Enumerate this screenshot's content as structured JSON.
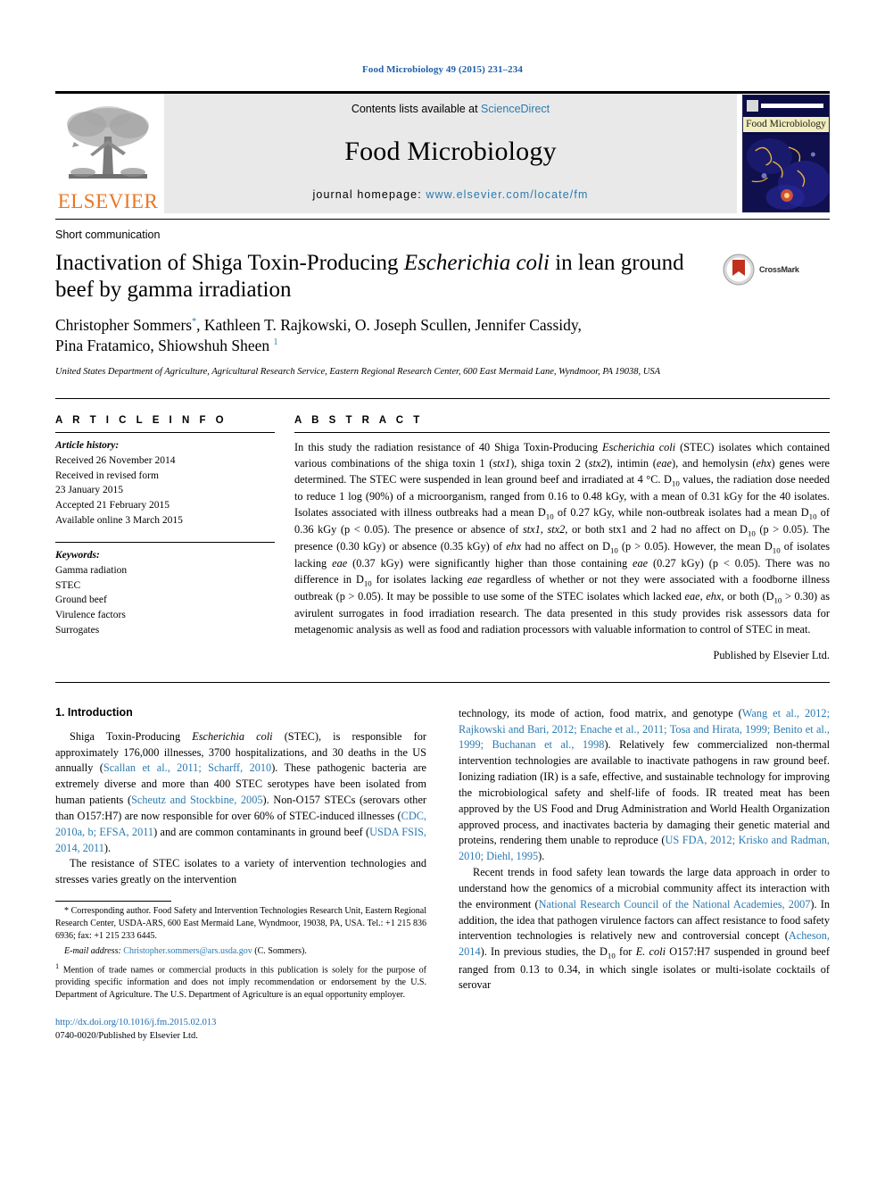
{
  "running_head": "Food Microbiology 49 (2015) 231–234",
  "masthead": {
    "publisher_name": "ELSEVIER",
    "contents_prefix": "Contents lists available at ",
    "contents_link": "ScienceDirect",
    "journal_title": "Food Microbiology",
    "homepage_prefix": "journal homepage: ",
    "homepage_url": "www.elsevier.com/locate/fm",
    "cover_label": "Food Microbiology"
  },
  "article": {
    "doctype": "Short communication",
    "title_part1": "Inactivation of Shiga Toxin-Producing ",
    "title_italic": "Escherichia coli",
    "title_part2": " in lean ground beef by gamma irradiation",
    "crossmark_label": "CrossMark",
    "authors_line1": "Christopher Sommers",
    "authors_line1_sup": "*",
    "authors_line1_rest": ", Kathleen T. Rajkowski, O. Joseph Scullen, Jennifer Cassidy,",
    "authors_line2": "Pina Fratamico, Shiowshuh Sheen",
    "authors_line2_sup": "1",
    "affiliation": "United States Department of Agriculture, Agricultural Research Service, Eastern Regional Research Center, 600 East Mermaid Lane, Wyndmoor, PA 19038, USA"
  },
  "info": {
    "heading": "A R T I C L E  I N F O",
    "history_label": "Article history:",
    "history": [
      "Received 26 November 2014",
      "Received in revised form",
      "23 January 2015",
      "Accepted 21 February 2015",
      "Available online 3 March 2015"
    ],
    "keywords_label": "Keywords:",
    "keywords": [
      "Gamma radiation",
      "STEC",
      "Ground beef",
      "Virulence factors",
      "Surrogates"
    ]
  },
  "abstract": {
    "heading": "A B S T R A C T",
    "published_by": "Published by Elsevier Ltd."
  },
  "introduction": {
    "heading": "1. Introduction"
  },
  "footnotes": {
    "corresponding": "* Corresponding author. Food Safety and Intervention Technologies Research Unit, Eastern Regional Research Center, USDA-ARS, 600 East Mermaid Lane, Wyndmoor, 19038, PA, USA. Tel.: +1 215 836 6936; fax: +1 215 233 6445.",
    "email_label": "E-mail address:",
    "email": "Christopher.sommers@ars.usda.gov",
    "email_suffix": " (C. Sommers).",
    "note1_marker": "1",
    "note1": " Mention of trade names or commercial products in this publication is solely for the purpose of providing specific information and does not imply recommendation or endorsement by the U.S. Department of Agriculture. The U.S. Department of Agriculture is an equal opportunity employer."
  },
  "footer": {
    "doi": "http://dx.doi.org/10.1016/j.fm.2015.02.013",
    "issn_line": "0740-0020/Published by Elsevier Ltd."
  },
  "colors": {
    "link_blue": "#2a7ab0",
    "elsevier_orange": "#e87722",
    "band_gray": "#e9e9e9"
  }
}
